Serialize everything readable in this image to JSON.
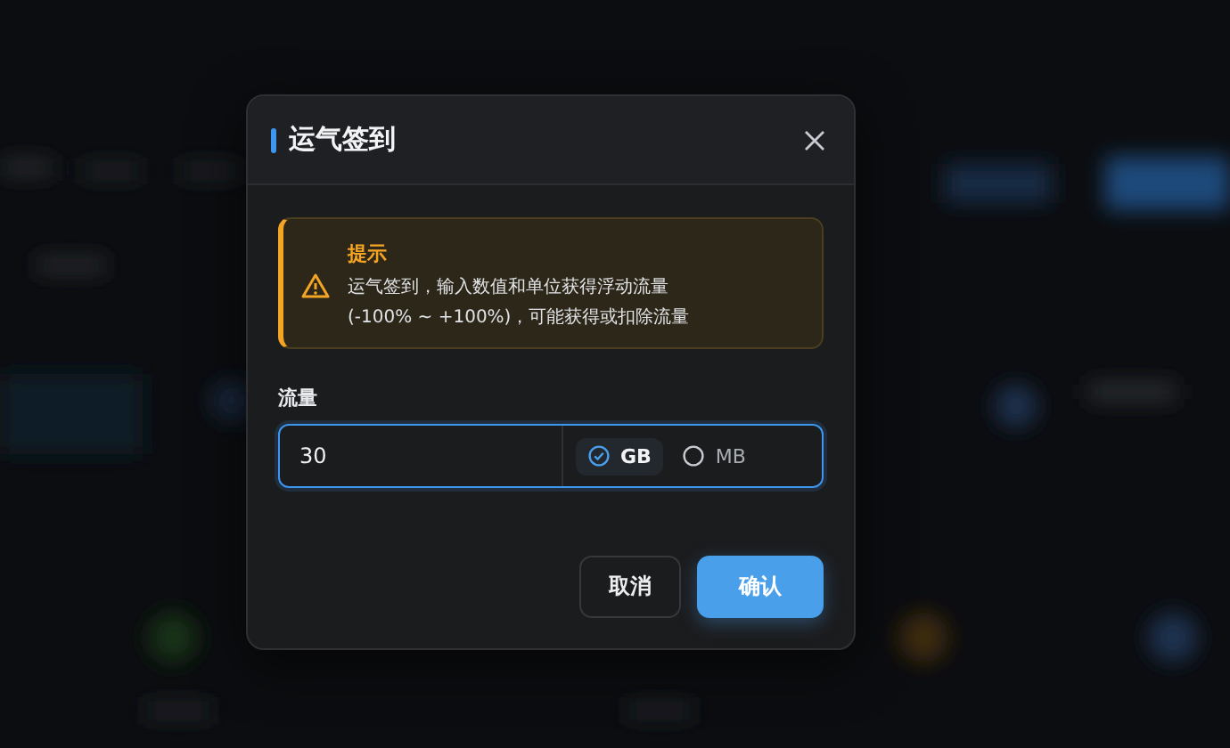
{
  "dialog": {
    "title": "运气签到",
    "alert": {
      "title": "提示",
      "lines": [
        "运气签到，输入数值和单位获得浮动流量",
        "(-100% ~ +100%)，可能获得或扣除流量"
      ]
    },
    "field": {
      "label": "流量",
      "value": "30",
      "units": [
        {
          "label": "GB",
          "selected": true
        },
        {
          "label": "MB",
          "selected": false
        }
      ]
    },
    "buttons": [
      {
        "label": "取消",
        "kind": "secondary"
      },
      {
        "label": "确认",
        "kind": "primary"
      }
    ]
  }
}
